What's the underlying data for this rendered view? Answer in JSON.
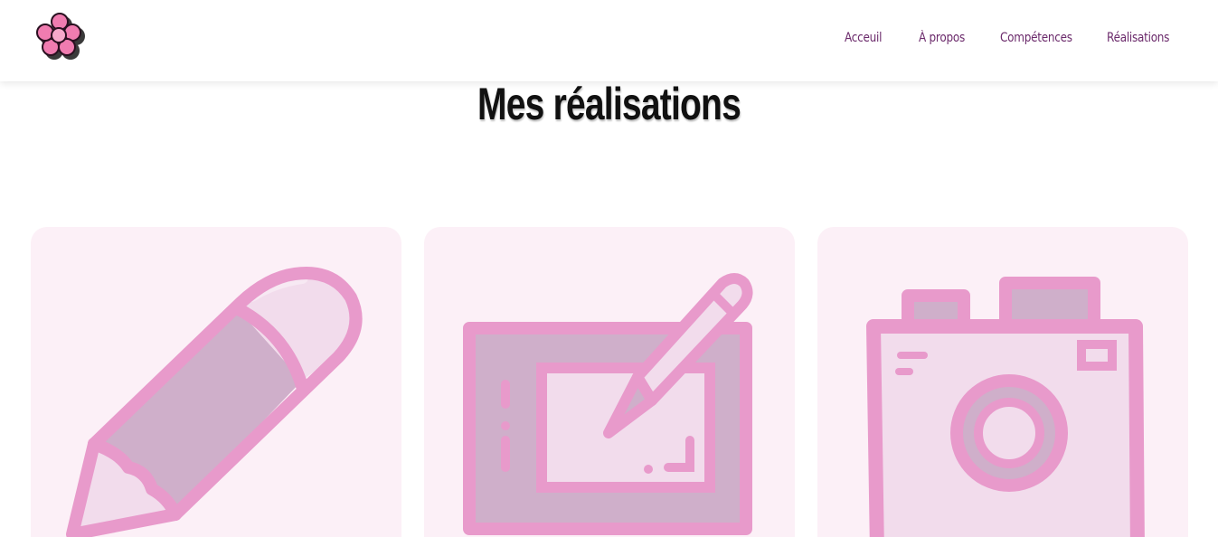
{
  "header": {
    "logo_icon": "flower-logo-icon",
    "nav": [
      {
        "label": "Acceuil"
      },
      {
        "label": "À propos"
      },
      {
        "label": "Compétences"
      },
      {
        "label": "Réalisations"
      }
    ]
  },
  "main": {
    "title": "Mes réalisations",
    "cards": [
      {
        "icon": "pencil-icon"
      },
      {
        "icon": "drawing-tablet-icon"
      },
      {
        "icon": "camera-icon"
      }
    ]
  },
  "colors": {
    "pink": "#e89acb",
    "light_pink": "#f2dcec",
    "mauve": "#cfafca",
    "card_bg": "#fcf0f7",
    "nav_text": "#6b2a6b"
  }
}
